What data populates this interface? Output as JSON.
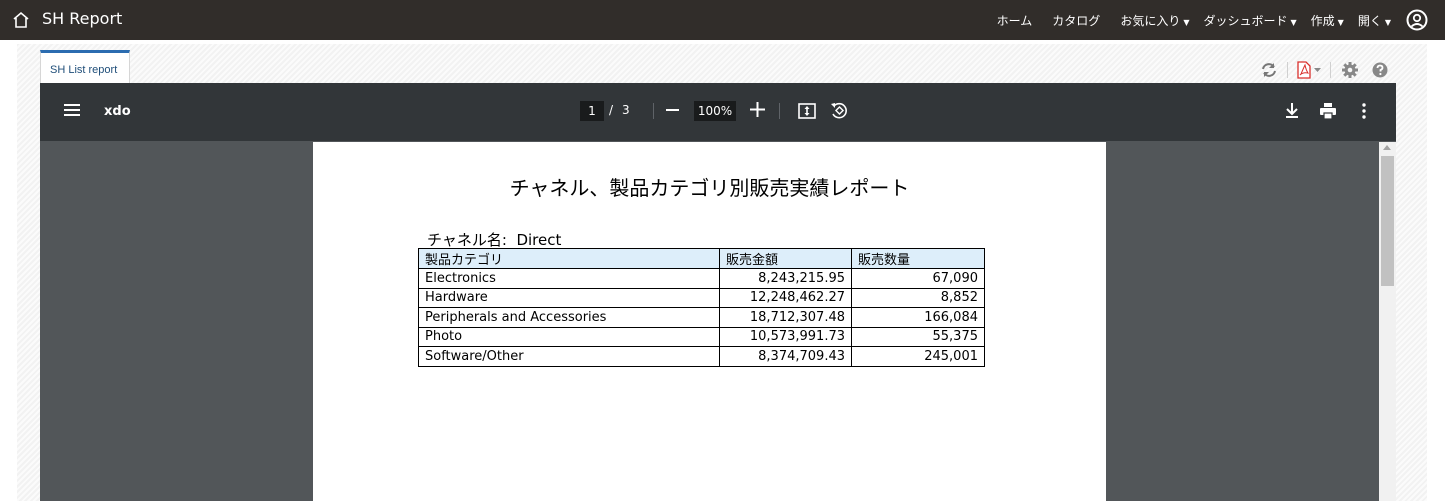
{
  "app": {
    "title": "SH Report"
  },
  "nav": {
    "home": "ホーム",
    "catalog": "カタログ",
    "favorites": "お気に入り",
    "dashboards": "ダッシュボード",
    "create": "作成",
    "open": "開く",
    "caret": "▼"
  },
  "tab": {
    "label": "SH List report"
  },
  "viewer": {
    "doc_title": "xdo",
    "page_current": "1",
    "page_separator": "/",
    "page_total": "3",
    "zoom": "100%"
  },
  "report": {
    "title": "チャネル、製品カテゴリ別販売実績レポート",
    "channel_label": "チャネル名:  Direct",
    "headers": [
      "製品カテゴリ",
      "販売金額",
      "販売数量"
    ],
    "rows": [
      [
        "Electronics",
        "8,243,215.95",
        "67,090"
      ],
      [
        "Hardware",
        "12,248,462.27",
        "8,852"
      ],
      [
        "Peripherals and Accessories",
        "18,712,307.48",
        "166,084"
      ],
      [
        "Photo",
        "10,573,991.73",
        "55,375"
      ],
      [
        "Software/Other",
        "8,374,709.43",
        "245,001"
      ]
    ]
  },
  "colors": {
    "topbar": "#312d2a",
    "viewer_toolbar": "#323639",
    "viewer_bg": "#525659",
    "table_header": "#ddeefa",
    "tab_accent": "#2b6cb0",
    "pdf_red": "#d9302c"
  },
  "icons": {
    "home": "home-icon",
    "user": "user-circle-icon",
    "refresh": "refresh-icon",
    "pdf": "pdf-icon",
    "settings": "gear-icon",
    "help": "help-icon",
    "menu": "menu-icon",
    "zoom_out": "minus-icon",
    "zoom_in": "plus-icon",
    "fit": "fit-page-icon",
    "rotate": "rotate-icon",
    "download": "download-icon",
    "print": "print-icon",
    "more": "more-vert-icon"
  }
}
